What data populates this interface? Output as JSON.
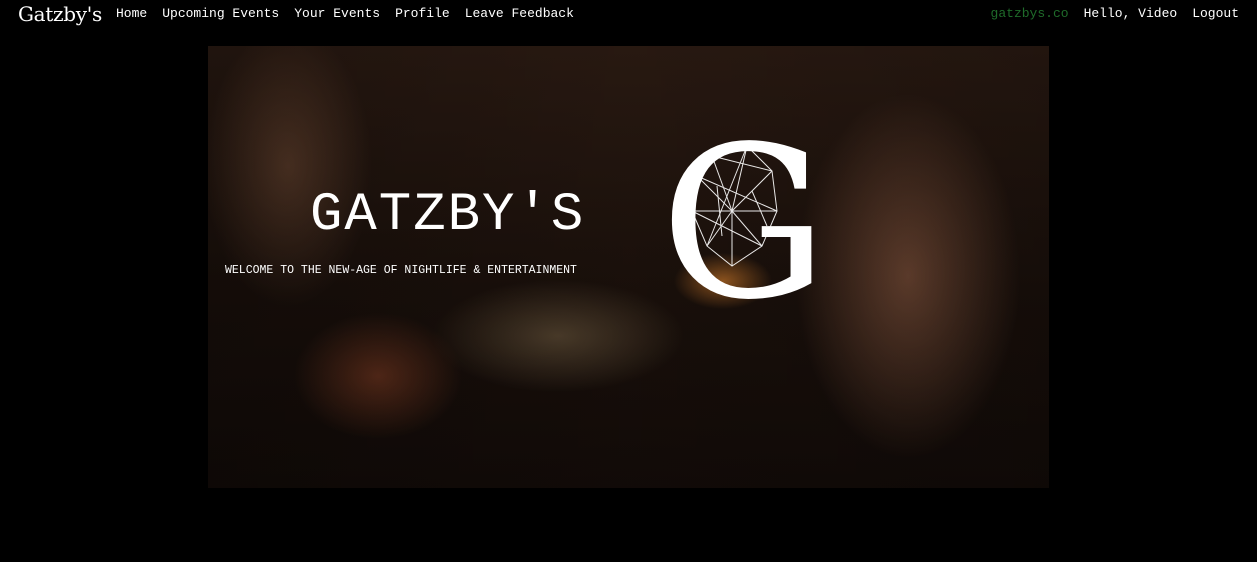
{
  "navbar": {
    "brand": "Gatzby's",
    "links": {
      "home": "Home",
      "upcoming_events": "Upcoming Events",
      "your_events": "Your Events",
      "profile": "Profile",
      "leave_feedback": "Leave Feedback"
    },
    "right": {
      "site_link": "gatzbys.co",
      "greeting": "Hello, Video",
      "logout": "Logout"
    }
  },
  "hero": {
    "title": "GATZBY'S",
    "tagline": "WELCOME TO THE NEW-AGE OF NIGHTLIFE & ENTERTAINMENT",
    "logo_letter": "G",
    "logo_icon": "lion-head-icon"
  },
  "colors": {
    "background": "#000000",
    "text": "#ffffff",
    "site_link": "#1f6b2a"
  }
}
